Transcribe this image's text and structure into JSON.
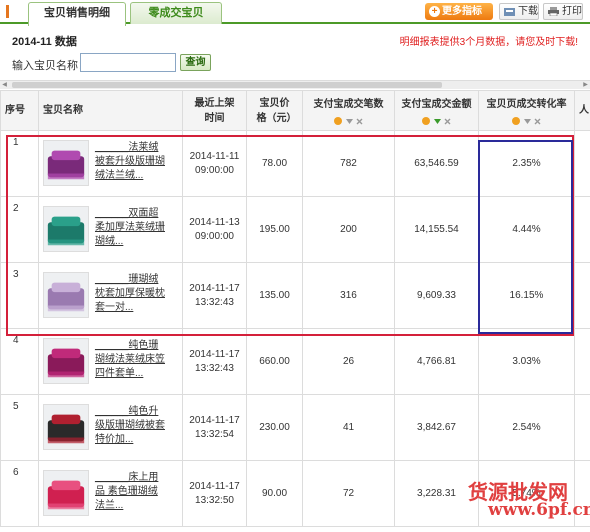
{
  "tabs": {
    "active": "宝贝销售明细",
    "inactive": "零成交宝贝"
  },
  "toolbar": {
    "more_label": "更多指标",
    "download_label": "下载",
    "print_label": "打印"
  },
  "info": {
    "period": "2014-11 数据",
    "notice": "明细报表提供3个月数据，请您及时下载!"
  },
  "search": {
    "label": "输入宝贝名称：",
    "value": "",
    "button": "查询"
  },
  "table": {
    "headers": {
      "index": "序号",
      "name": "宝贝名称",
      "listed_time": "最近上架时间",
      "price": "宝贝价格（元）",
      "pay_count": "支付宝成交笔数",
      "pay_amount": "支付宝成交金额",
      "conversion": "宝贝页成交转化率",
      "extra": "人"
    },
    "rows": [
      {
        "index": "1",
        "name": "______法莱绒被套升级版珊瑚绒法兰绒...",
        "date": "2014-11-11",
        "time": "09:00:00",
        "price": "78.00",
        "count": "782",
        "amount": "63,546.59",
        "rate": "2.35%"
      },
      {
        "index": "2",
        "name": "______双面超柔加厚法莱绒珊瑚绒...",
        "date": "2014-11-13",
        "time": "09:00:00",
        "price": "195.00",
        "count": "200",
        "amount": "14,155.54",
        "rate": "4.44%"
      },
      {
        "index": "3",
        "name": "______珊瑚绒枕套加厚保暖枕套一对...",
        "date": "2014-11-17",
        "time": "13:32:43",
        "price": "135.00",
        "count": "316",
        "amount": "9,609.33",
        "rate": "16.15%"
      },
      {
        "index": "4",
        "name": "______纯色珊瑚绒法莱绒床笠四件套单...",
        "date": "2014-11-17",
        "time": "13:32:43",
        "price": "660.00",
        "count": "26",
        "amount": "4,766.81",
        "rate": "3.03%"
      },
      {
        "index": "5",
        "name": "______纯色升级版珊瑚绒被套 特价加...",
        "date": "2014-11-17",
        "time": "13:32:54",
        "price": "230.00",
        "count": "41",
        "amount": "3,842.67",
        "rate": "2.54%"
      },
      {
        "index": "6",
        "name": "______床上用品 素色珊瑚绒法兰...",
        "date": "2014-11-17",
        "time": "13:32:50",
        "price": "90.00",
        "count": "72",
        "amount": "3,228.31",
        "rate": "5.74%"
      }
    ]
  },
  "watermark": {
    "line1": "货源批发网",
    "line2": "www.6pf.cn"
  },
  "colors": {
    "tab_border": "#4c9a28",
    "notice": "#e02020",
    "red_frame": "#d4203a",
    "blue_frame": "#2a2a9a",
    "more_button": "#ee7a10"
  }
}
